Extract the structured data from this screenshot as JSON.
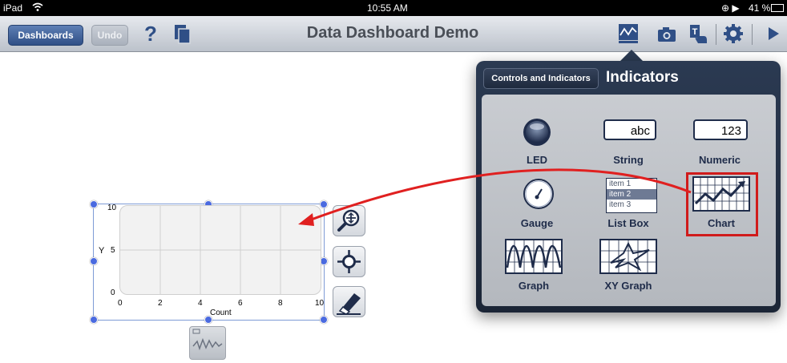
{
  "status_bar": {
    "device": "iPad",
    "time": "10:55 AM",
    "battery": "41 %"
  },
  "toolbar": {
    "dashboards_label": "Dashboards",
    "undo_label": "Undo",
    "title": "Data Dashboard Demo",
    "icons": [
      "help-icon",
      "copy-icon",
      "chart-icon",
      "camera-icon",
      "text-touch-icon",
      "gear-icon",
      "play-icon"
    ]
  },
  "chart_widget": {
    "y_label": "Y",
    "x_label": "Count",
    "y_ticks": [
      "10",
      "5",
      "0"
    ],
    "x_ticks": [
      "0",
      "2",
      "4",
      "6",
      "8",
      "10"
    ]
  },
  "popover": {
    "back_label": "Controls and Indicators",
    "title": "Indicators",
    "items": [
      {
        "label": "LED"
      },
      {
        "label": "String",
        "preview": "abc"
      },
      {
        "label": "Numeric",
        "preview": "123"
      },
      {
        "label": "Gauge"
      },
      {
        "label": "List Box",
        "list": [
          "item 1",
          "item 2",
          "item 3"
        ]
      },
      {
        "label": "Chart"
      },
      {
        "label": "Graph"
      },
      {
        "label": "XY Graph"
      }
    ]
  },
  "colors": {
    "accent": "#2f4f86",
    "highlight": "#d01b1b",
    "arrow": "#e02020"
  }
}
